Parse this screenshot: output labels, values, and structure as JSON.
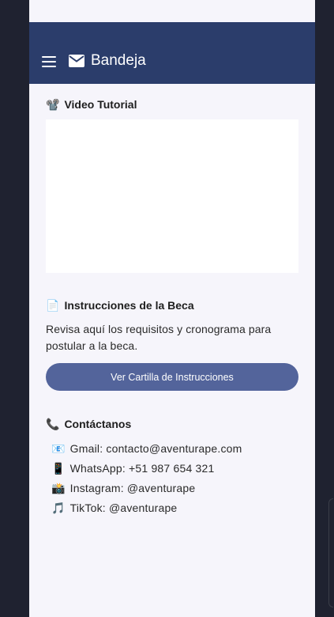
{
  "appbar": {
    "title": "Bandeja",
    "menu_icon": "menu-icon",
    "mail_icon": "mail-icon"
  },
  "video": {
    "icon": "📽️",
    "title": "Video Tutorial"
  },
  "instructions": {
    "icon": "📄",
    "title": "Instrucciones de la Beca",
    "description": "Revisa aquí los requisitos y cronograma para postular a la beca.",
    "button_label": "Ver Cartilla de Instrucciones"
  },
  "contact": {
    "icon": "📞",
    "title": "Contáctanos",
    "items": [
      {
        "icon": "📧",
        "text": "Gmail: contacto@aventurape.com"
      },
      {
        "icon": "📱",
        "text": "WhatsApp: +51 987 654 321"
      },
      {
        "icon": "📸",
        "text": "Instagram: @aventurape"
      },
      {
        "icon": "🎵",
        "text": "TikTok: @aventurape"
      }
    ]
  },
  "colors": {
    "appbar": "#2b3d6b",
    "button": "#53649b",
    "background": "#f6f5fb"
  }
}
